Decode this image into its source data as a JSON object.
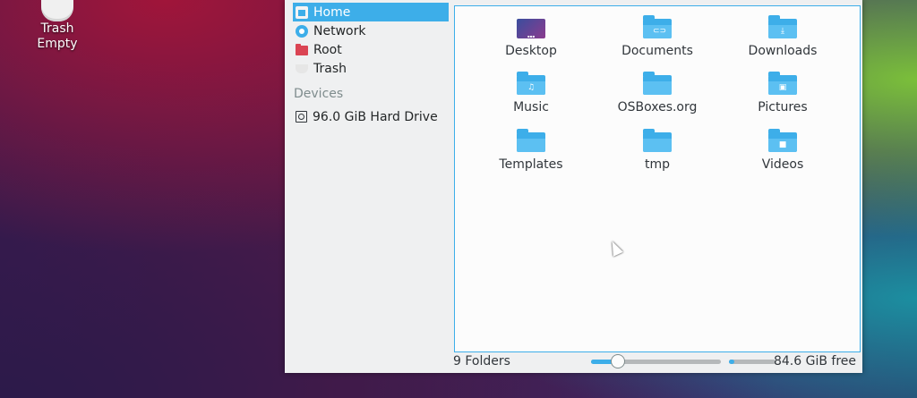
{
  "desktop": {
    "trash_label": "Trash",
    "trash_status": "Empty"
  },
  "sidebar": {
    "places": [
      {
        "label": "Home",
        "icon": "home-icon",
        "selected": true
      },
      {
        "label": "Network",
        "icon": "network-icon"
      },
      {
        "label": "Root",
        "icon": "root-folder-icon"
      },
      {
        "label": "Trash",
        "icon": "trash-icon"
      }
    ],
    "devices_heading": "Devices",
    "devices": [
      {
        "label": "96.0 GiB Hard Drive",
        "icon": "hard-drive-icon"
      }
    ]
  },
  "folders": [
    {
      "name": "Desktop",
      "icon": "desktop-folder-icon"
    },
    {
      "name": "Documents",
      "icon": "documents-folder-icon",
      "glyph": "⊂⊃"
    },
    {
      "name": "Downloads",
      "icon": "downloads-folder-icon",
      "glyph": "⤓"
    },
    {
      "name": "Music",
      "icon": "music-folder-icon",
      "glyph": "♫"
    },
    {
      "name": "OSBoxes.org",
      "icon": "folder-icon",
      "glyph": ""
    },
    {
      "name": "Pictures",
      "icon": "pictures-folder-icon",
      "glyph": "▣"
    },
    {
      "name": "Templates",
      "icon": "folder-icon",
      "glyph": ""
    },
    {
      "name": "tmp",
      "icon": "folder-icon",
      "glyph": ""
    },
    {
      "name": "Videos",
      "icon": "videos-folder-icon",
      "glyph": "■"
    }
  ],
  "status": {
    "count_text": "9 Folders",
    "zoom_level": 0.17,
    "free_space_text": "84.6 GiB free",
    "used_fraction": 0.12
  },
  "colors": {
    "accent": "#3daee9",
    "folder": "#3daee9",
    "root": "#da4453"
  }
}
